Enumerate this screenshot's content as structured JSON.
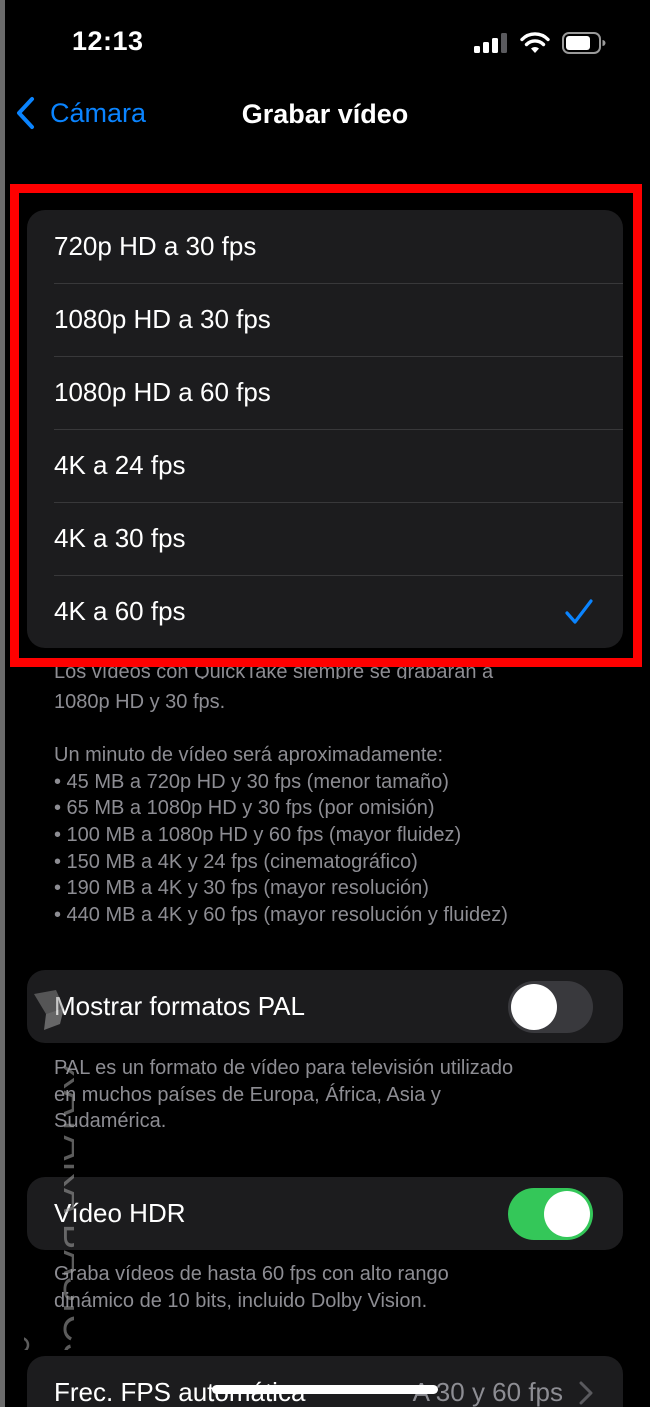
{
  "status_bar": {
    "time": "12:13"
  },
  "nav": {
    "back_label": "Cámara",
    "title": "Grabar vídeo"
  },
  "resolution_options": [
    {
      "label": "720p HD a 30 fps",
      "selected": false
    },
    {
      "label": "1080p HD a 30 fps",
      "selected": false
    },
    {
      "label": "1080p HD a 60 fps",
      "selected": false
    },
    {
      "label": "4K a 24 fps",
      "selected": false
    },
    {
      "label": "4K a 30 fps",
      "selected": false
    },
    {
      "label": "4K a 60 fps",
      "selected": true
    }
  ],
  "resolution_footer": {
    "partial_line": "Los vídeos con QuickTake siempre se grabarán a",
    "line1": "1080p HD y 30 fps.",
    "intro": "Un minuto de vídeo será aproximadamente:",
    "items": [
      "• 45 MB a 720p HD y 30 fps (menor tamaño)",
      "• 65 MB a 1080p HD y 30 fps (por omisión)",
      "• 100 MB a 1080p HD y 60 fps (mayor fluidez)",
      "• 150 MB a 4K y 24 fps (cinematográfico)",
      "• 190 MB a 4K y 30 fps (mayor resolución)",
      "• 440 MB a 4K y 60 fps (mayor resolución y fluidez)"
    ]
  },
  "pal": {
    "label": "Mostrar formatos PAL",
    "enabled": false,
    "footer": [
      "PAL es un formato de vídeo para televisión utilizado",
      "en muchos países de Europa, África, Asia y",
      "Sudamérica."
    ]
  },
  "hdr": {
    "label": "Vídeo HDR",
    "enabled": true,
    "footer": [
      "Graba vídeos de hasta 60 fps con alto rango",
      "dinámico de 10 bits, incluido Dolby Vision."
    ]
  },
  "auto_fps": {
    "label": "Frec. FPS automática",
    "value": "A 30 y 60 fps"
  },
  "watermark": {
    "text": "XATAKA BASICS"
  },
  "colors": {
    "accent": "#0a84ff",
    "highlight": "#ff0000",
    "toggle_on": "#34c759"
  }
}
